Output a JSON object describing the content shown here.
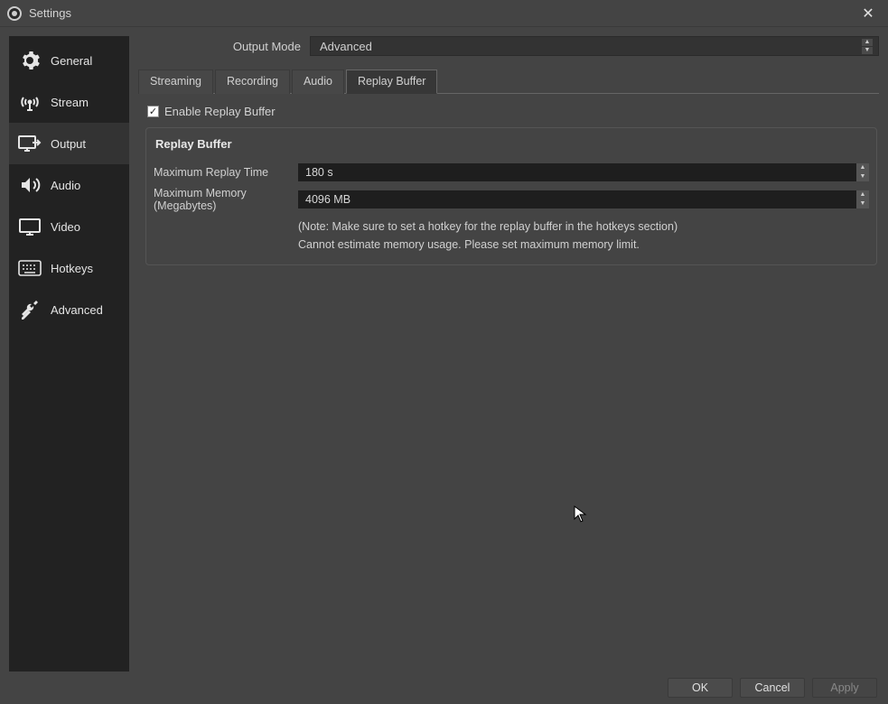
{
  "window": {
    "title": "Settings"
  },
  "sidebar": {
    "items": [
      {
        "label": "General"
      },
      {
        "label": "Stream"
      },
      {
        "label": "Output"
      },
      {
        "label": "Audio"
      },
      {
        "label": "Video"
      },
      {
        "label": "Hotkeys"
      },
      {
        "label": "Advanced"
      }
    ],
    "selected": "Output"
  },
  "output_mode": {
    "label": "Output Mode",
    "value": "Advanced"
  },
  "tabs": [
    {
      "label": "Streaming"
    },
    {
      "label": "Recording"
    },
    {
      "label": "Audio"
    },
    {
      "label": "Replay Buffer"
    }
  ],
  "active_tab": "Replay Buffer",
  "replay_buffer": {
    "enable_label": "Enable Replay Buffer",
    "enabled": true,
    "group_title": "Replay Buffer",
    "max_time_label": "Maximum Replay Time",
    "max_time_value": "180 s",
    "max_mem_label": "Maximum Memory (Megabytes)",
    "max_mem_value": "4096 MB",
    "note": "(Note: Make sure to set a hotkey for the replay buffer in the hotkeys section)",
    "warning": "Cannot estimate memory usage. Please set maximum memory limit."
  },
  "footer": {
    "ok": "OK",
    "cancel": "Cancel",
    "apply": "Apply"
  }
}
